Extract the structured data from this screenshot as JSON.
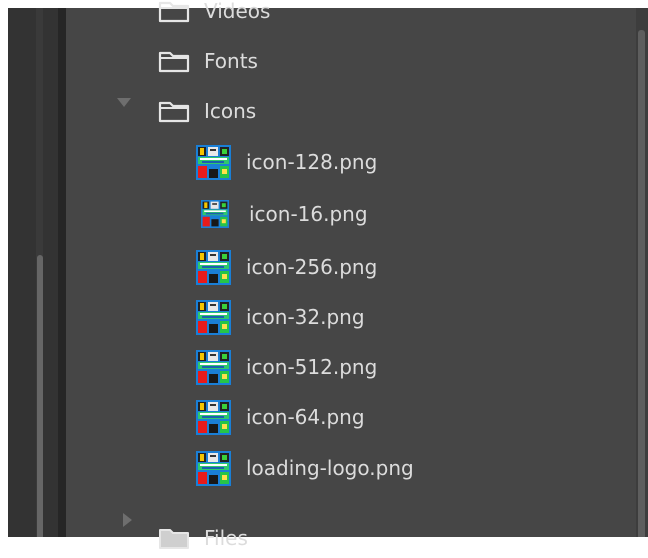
{
  "tree": {
    "folders": [
      {
        "label": "Videos",
        "icon": "folder-icon"
      },
      {
        "label": "Fonts",
        "icon": "folder-icon"
      },
      {
        "label": "Icons",
        "icon": "folder-icon",
        "expanded": true
      },
      {
        "label": "Files",
        "icon": "folder-icon",
        "expanded": false
      }
    ],
    "files": [
      {
        "label": "icon-128.png",
        "icon": "png-file-icon"
      },
      {
        "label": "icon-16.png",
        "icon": "png-file-icon"
      },
      {
        "label": "icon-256.png",
        "icon": "png-file-icon"
      },
      {
        "label": "icon-32.png",
        "icon": "png-file-icon"
      },
      {
        "label": "icon-512.png",
        "icon": "png-file-icon"
      },
      {
        "label": "icon-64.png",
        "icon": "png-file-icon"
      },
      {
        "label": "loading-logo.png",
        "icon": "png-file-icon"
      }
    ]
  },
  "colors": {
    "panel_bg": "#464646",
    "text": "#dcdcdc",
    "caret": "#6e6e6e"
  }
}
